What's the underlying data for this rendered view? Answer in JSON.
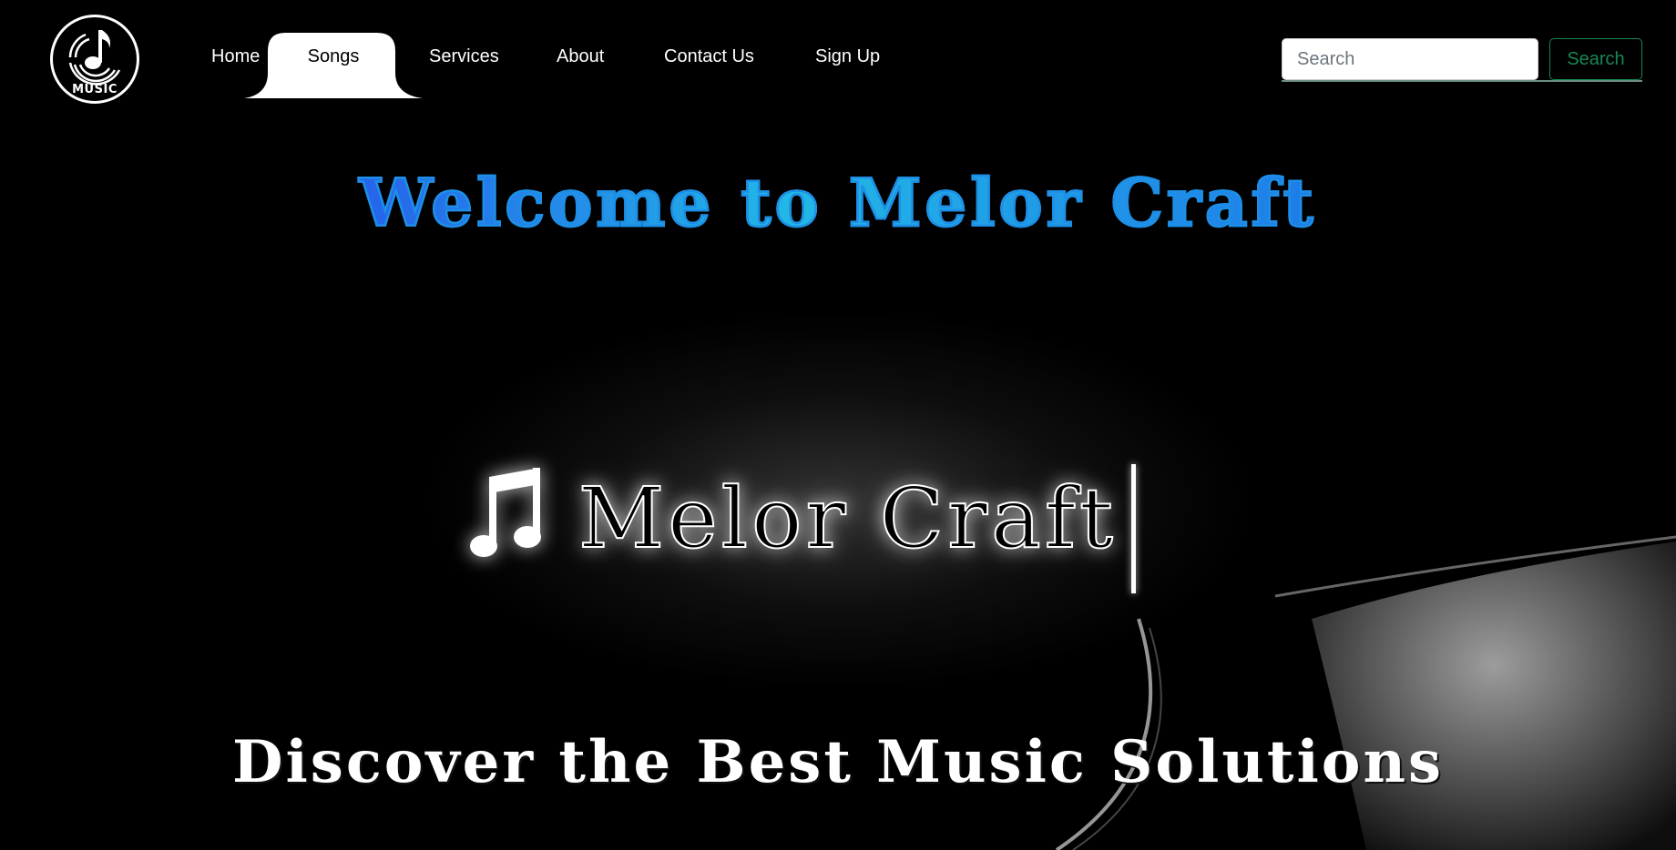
{
  "navbar": {
    "logo_text": "MUSIC",
    "items": [
      {
        "label": "Home"
      },
      {
        "label": "Songs"
      },
      {
        "label": "Services"
      },
      {
        "label": "About"
      },
      {
        "label": "Contact Us"
      },
      {
        "label": "Sign Up"
      }
    ],
    "active_item": "Songs",
    "search": {
      "placeholder": "Search",
      "value": "",
      "button_label": "Search"
    }
  },
  "hero": {
    "welcome_title": "Welcome to Melor Craft",
    "brand_text": "Melor Craft",
    "tagline": "Discover the Best Music Solutions"
  },
  "icons": {
    "logo": "music-note-record-icon",
    "hero": "music-notes-icon"
  },
  "colors": {
    "background": "#000000",
    "welcome_gradient_start": "#2563eb",
    "welcome_gradient_end": "#22b8e6",
    "search_button": "#198754",
    "text": "#ffffff"
  }
}
